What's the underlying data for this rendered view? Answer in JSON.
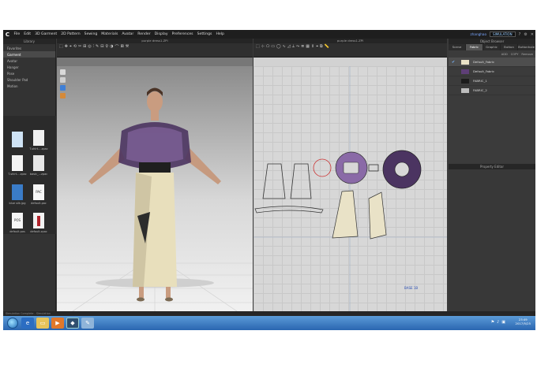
{
  "app": {
    "logo": "C",
    "menu": [
      "File",
      "Edit",
      "3D Garment",
      "2D Pattern",
      "Sewing",
      "Materials",
      "Avatar",
      "Render",
      "Display",
      "Preferences",
      "Settings",
      "Help"
    ],
    "user": "zhanghao",
    "mode": "SIMULATION",
    "window_controls": [
      "?",
      "⚙",
      "✕"
    ]
  },
  "library": {
    "title": "Library",
    "tree": [
      "Favorites",
      "Garment",
      "Avatar",
      "Hanger",
      "Pose",
      "Shoulder Pad",
      "Motion"
    ],
    "selected": "Garment",
    "files": [
      "",
      "T-shirt....zpac",
      "T-shirt....zpac",
      "basic_...zpac",
      "blue silk.jpg",
      "default.pac",
      "default.pos",
      "default.zpac"
    ],
    "file_badges": [
      "",
      "",
      "",
      "",
      "",
      "PAC",
      "POS",
      ""
    ]
  },
  "viewport3d": {
    "title": "purple dress1.ZPI"
  },
  "viewport2d": {
    "title": "purple dress1.ZPI",
    "label": "BASE 1B"
  },
  "object_browser": {
    "title": "Object Browser",
    "tabs": [
      "Scene",
      "Fabric",
      "Graphic",
      "Button",
      "Buttonhole"
    ],
    "active_tab": "Fabric",
    "actions": [
      "ADD",
      "COPY",
      "Remove"
    ],
    "fabrics": [
      {
        "name": "Default_Fabric",
        "color": "#e9e2c7",
        "selected": true
      },
      {
        "name": "Default_Fabric",
        "color": "#5e3f77",
        "selected": false
      },
      {
        "name": "FABRIC_1",
        "color": "#1c1c1c",
        "selected": false
      },
      {
        "name": "FABRIC_2",
        "color": "#bdbdbd",
        "selected": false
      }
    ]
  },
  "property_editor": {
    "title": "Property Editor"
  },
  "status": {
    "text": "Simulation Complete - Simulation"
  },
  "taskbar": {
    "time": "23:49",
    "date": "2017/5/25"
  }
}
